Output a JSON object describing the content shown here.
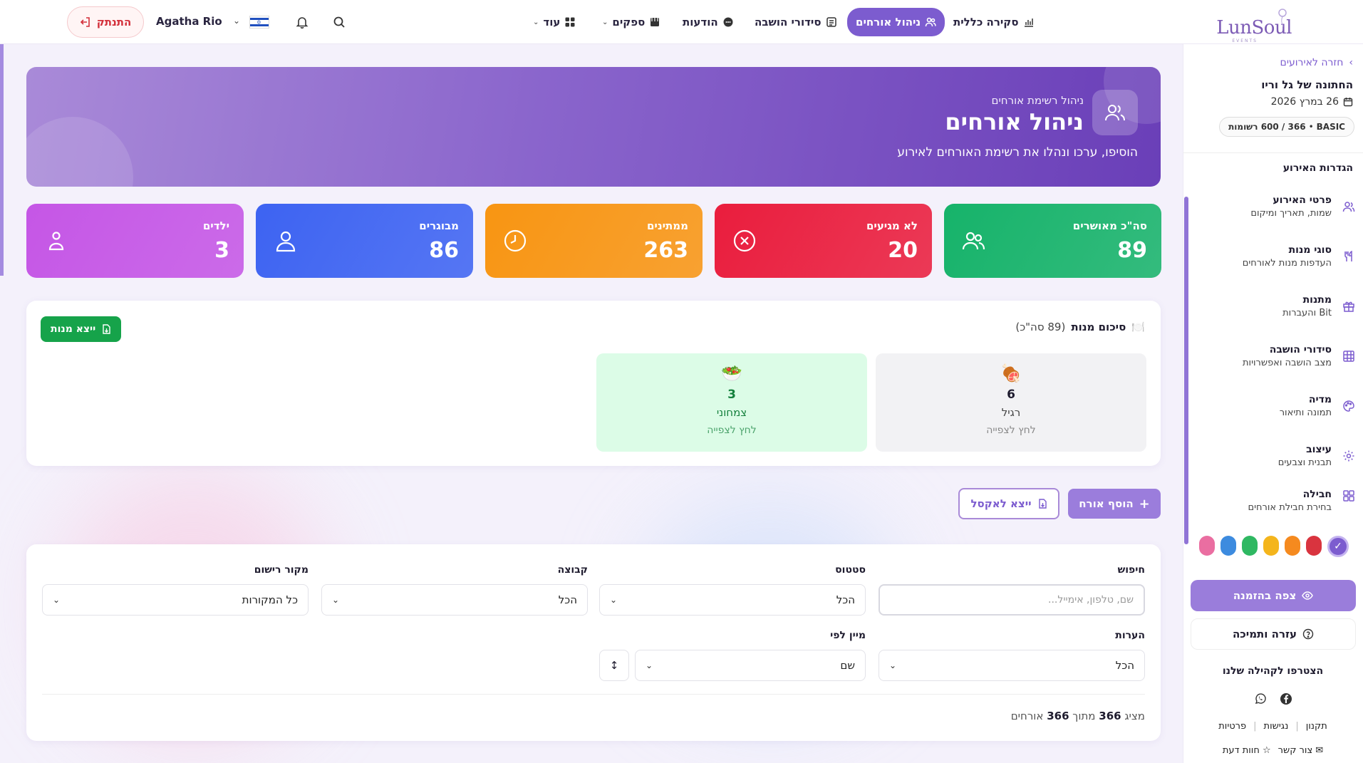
{
  "brand": {
    "name": "LunSoul",
    "sub": "EVENTS"
  },
  "nav": {
    "overview": "סקירה כללית",
    "guests": "ניהול אורחים",
    "seating": "סידורי הושבה",
    "messages": "הודעות",
    "suppliers": "ספקים",
    "more": "עוד"
  },
  "user": {
    "name": "Agatha Rio",
    "logout": "התנתק"
  },
  "sidebar": {
    "back": "חזרה לאירועים",
    "event_title": "החתונה של גל וריו",
    "event_date": "26 במרץ 2026",
    "package_tier": "BASIC",
    "package_usage": "366 / 600 רשומות",
    "section_title": "הגדרות האירוע",
    "items": [
      {
        "title": "פרטי האירוע",
        "sub": "שמות, תאריך ומיקום"
      },
      {
        "title": "סוגי מנות",
        "sub": "העדפות מנות לאורחים"
      },
      {
        "title": "מתנות",
        "sub": "Bit והעברות"
      },
      {
        "title": "סידורי הושבה",
        "sub": "מצב הושבה ואפשרויות"
      },
      {
        "title": "מדיה",
        "sub": "תמונה ותיאור"
      },
      {
        "title": "עיצוב",
        "sub": "תבנית וצבעים"
      },
      {
        "title": "חבילה",
        "sub": "בחירת חבילת אורחים"
      }
    ],
    "swatches": [
      "#7c5ccf",
      "#d9343f",
      "#f58a1f",
      "#f4b51c",
      "#2fb862",
      "#3d8bdf",
      "#ea6ea1"
    ],
    "view_invite": "צפה בהזמנה",
    "help": "עזרה ותמיכה",
    "community": "הצטרפו לקהילה שלנו",
    "links": [
      "תקנון",
      "נגישות",
      "פרטיות"
    ],
    "contact": "צור קשר",
    "feedback": "חוות דעת"
  },
  "hero": {
    "subtitle": "ניהול רשימת אורחים",
    "title": "ניהול אורחים",
    "description": "הוסיפו, ערכו ונהלו את רשימת האורחים לאירוע"
  },
  "stats": [
    {
      "label": "סה\"כ מאושרים",
      "value": "89",
      "color": "#16b36a",
      "icon": "users-icon"
    },
    {
      "label": "לא מגיעים",
      "value": "20",
      "color": "#ea1d3d",
      "icon": "x-circle-icon"
    },
    {
      "label": "ממתינים",
      "value": "263",
      "color": "#f89512",
      "icon": "clock-icon"
    },
    {
      "label": "מבוגרים",
      "value": "86",
      "color": "#3d63f2",
      "icon": "user-icon"
    },
    {
      "label": "ילדים",
      "value": "3",
      "color": "#c556e6",
      "icon": "child-icon"
    }
  ],
  "meals": {
    "title": "סיכום מנות",
    "total": "(89 סה\"כ)",
    "export": "ייצא מנות",
    "items": [
      {
        "emoji": "🍖",
        "count": "6",
        "name": "רגיל",
        "hint": "לחץ לצפייה"
      },
      {
        "emoji": "🥗",
        "count": "3",
        "name": "צמחוני",
        "hint": "לחץ לצפייה"
      }
    ]
  },
  "actions": {
    "add_guest": "הוסף אורח",
    "export_excel": "ייצא לאקסל"
  },
  "filters": {
    "search_label": "חיפוש",
    "search_placeholder": "שם, טלפון, אימייל...",
    "status_label": "סטטוס",
    "status_value": "הכל",
    "group_label": "קבוצה",
    "group_value": "הכל",
    "source_label": "מקור רישום",
    "source_value": "כל המקורות",
    "notes_label": "הערות",
    "notes_value": "הכל",
    "sort_label": "מיין לפי",
    "sort_value": "שם",
    "sort_dir": "↕"
  },
  "showing": {
    "prefix": "מציג",
    "shown": "366",
    "middle": "מתוך",
    "total": "366",
    "suffix": "אורחים"
  }
}
